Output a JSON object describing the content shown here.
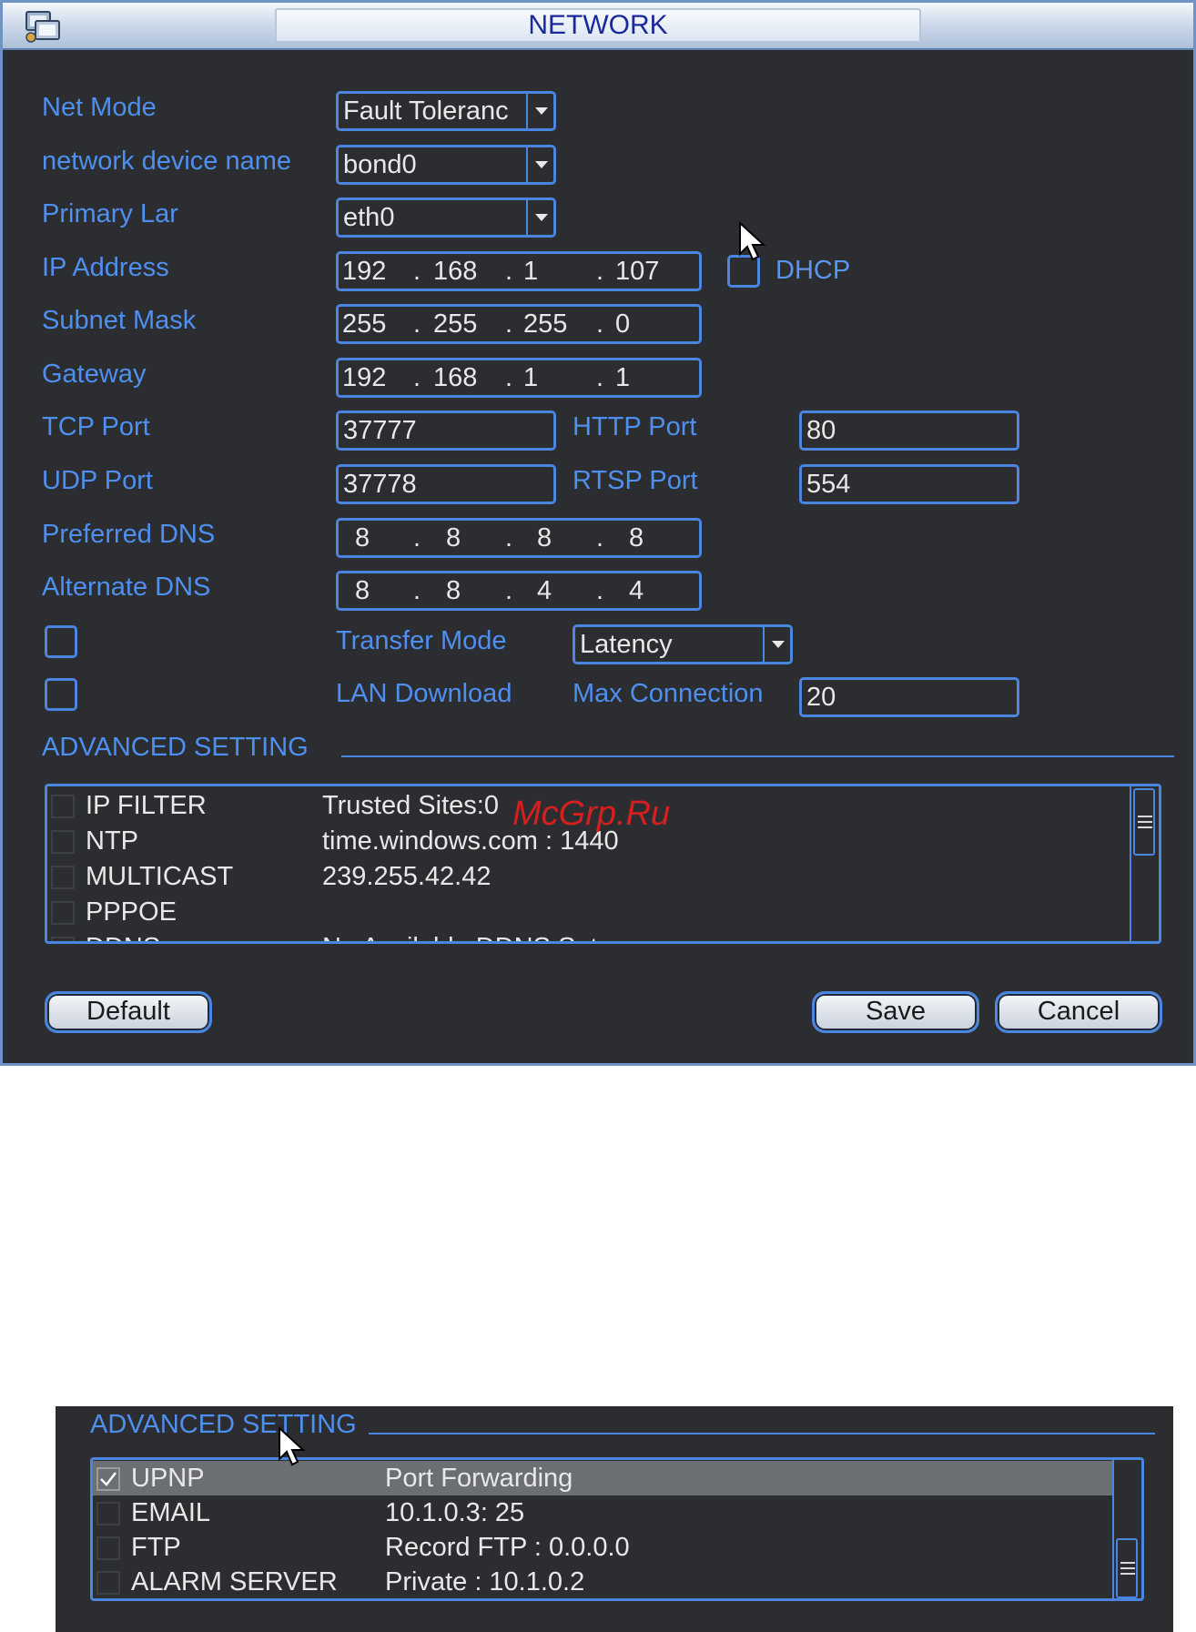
{
  "window": {
    "title": "NETWORK"
  },
  "fields": {
    "net_mode": {
      "label": "Net Mode",
      "value": "Fault Toleranc"
    },
    "device_name": {
      "label": "network device name",
      "value": "bond0"
    },
    "primary_lan": {
      "label": "Primary Lar",
      "value": "eth0"
    },
    "ip_address": {
      "label": "IP Address",
      "octets": [
        "192",
        "168",
        "1",
        "107"
      ]
    },
    "dhcp": {
      "label": "DHCP",
      "checked": false
    },
    "subnet_mask": {
      "label": "Subnet Mask",
      "octets": [
        "255",
        "255",
        "255",
        "0"
      ]
    },
    "gateway": {
      "label": "Gateway",
      "octets": [
        "192",
        "168",
        "1",
        "1"
      ]
    },
    "tcp_port": {
      "label": "TCP Port",
      "value": "37777"
    },
    "http_port": {
      "label": "HTTP Port",
      "value": "80"
    },
    "udp_port": {
      "label": "UDP Port",
      "value": "37778"
    },
    "rtsp_port": {
      "label": "RTSP Port",
      "value": "554"
    },
    "preferred_dns": {
      "label": "Preferred DNS",
      "octets": [
        "8",
        "8",
        "8",
        "8"
      ]
    },
    "alternate_dns": {
      "label": "Alternate DNS",
      "octets": [
        "8",
        "8",
        "4",
        "4"
      ]
    },
    "transfer_mode": {
      "label": "Transfer Mode",
      "value": "Latency",
      "checked": false
    },
    "lan_download": {
      "label": "LAN Download",
      "checked": false
    },
    "max_connection": {
      "label": "Max Connection",
      "value": "20"
    }
  },
  "advanced": {
    "title": "ADVANCED SETTING",
    "rows": [
      {
        "name": "IP FILTER",
        "value": "Trusted Sites:0",
        "checked": false
      },
      {
        "name": "NTP",
        "value": "time.windows.com : 1440",
        "checked": false
      },
      {
        "name": "MULTICAST",
        "value": "239.255.42.42",
        "checked": false
      },
      {
        "name": "PPPOE",
        "value": "",
        "checked": false
      },
      {
        "name": "DDNS",
        "value": "No Available DDNS Set",
        "checked": false
      }
    ]
  },
  "buttons": {
    "default": "Default",
    "save": "Save",
    "cancel": "Cancel"
  },
  "watermark": "McGrp.Ru",
  "advanced2": {
    "title": "ADVANCED SETTING",
    "rows": [
      {
        "name": "UPNP",
        "value": "Port Forwarding",
        "checked": true,
        "selected": true
      },
      {
        "name": "EMAIL",
        "value": "10.1.0.3: 25",
        "checked": false
      },
      {
        "name": "FTP",
        "value": "Record FTP : 0.0.0.0",
        "checked": false
      },
      {
        "name": "ALARM SERVER",
        "value": "Private : 10.1.0.2",
        "checked": false
      }
    ]
  },
  "colors": {
    "accent": "#4a86df",
    "label": "#4f8ff0",
    "panel": "#2b2d30",
    "text": "#e8e8e8",
    "watermark": "#d62020"
  }
}
